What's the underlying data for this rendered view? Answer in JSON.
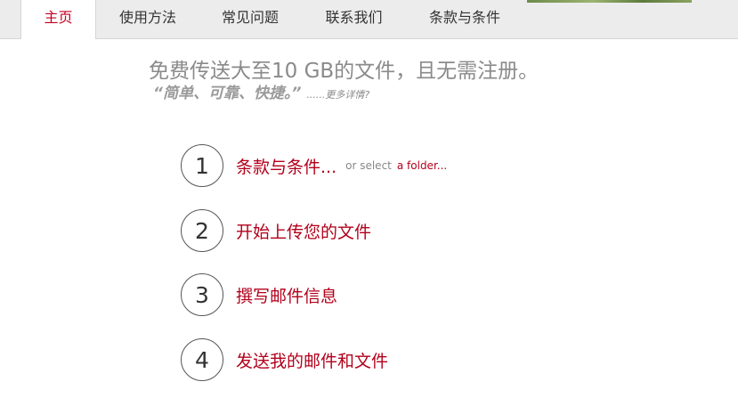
{
  "nav": {
    "tabs": [
      {
        "label": "主页",
        "active": true
      },
      {
        "label": "使用方法",
        "active": false
      },
      {
        "label": "常见问题",
        "active": false
      },
      {
        "label": "联系我们",
        "active": false
      },
      {
        "label": "条款与条件",
        "active": false
      }
    ]
  },
  "hero": {
    "headline": "免费传送大至10 GB的文件，且无需注册。",
    "tagline": "“简单、可靠、快捷。”",
    "more_link": "......更多详情?"
  },
  "steps": [
    {
      "number": "1",
      "label": "条款与条件...",
      "or_text": "or select",
      "folder_link": "a folder..."
    },
    {
      "number": "2",
      "label": "开始上传您的文件"
    },
    {
      "number": "3",
      "label": "撰写邮件信息"
    },
    {
      "number": "4",
      "label": "发送我的邮件和文件"
    }
  ],
  "colors": {
    "accent": "#b3001b",
    "nav_bg": "#ececec",
    "text_gray": "#8a8a8a"
  }
}
